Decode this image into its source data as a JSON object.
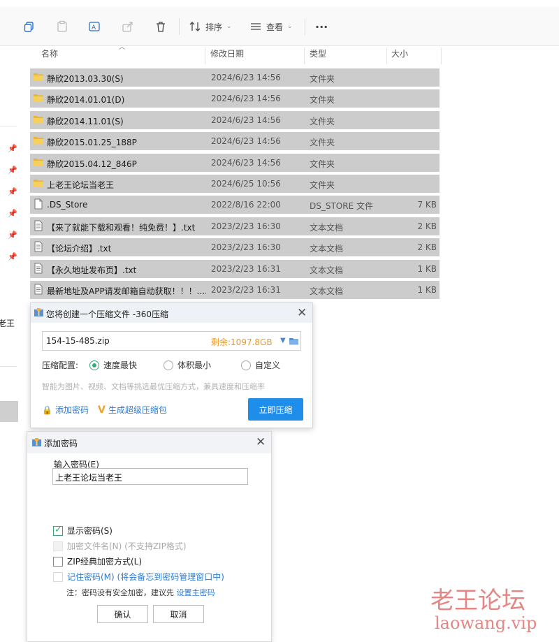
{
  "toolbar": {
    "sort_label": "排序",
    "view_label": "查看",
    "more_label": "···"
  },
  "columns": {
    "name": "名称",
    "date": "修改日期",
    "type": "类型",
    "size": "大小"
  },
  "files": [
    {
      "name": "静欣2013.03.30(S)",
      "date": "2024/6/23 14:56",
      "type": "文件夹",
      "size": "",
      "icon": "folder-icon",
      "selected": true
    },
    {
      "name": "静欣2014.01.01(D)",
      "date": "2024/6/23 14:56",
      "type": "文件夹",
      "size": "",
      "icon": "folder-icon",
      "selected": true
    },
    {
      "name": "静欣2014.11.01(S)",
      "date": "2024/6/23 14:56",
      "type": "文件夹",
      "size": "",
      "icon": "folder-icon",
      "selected": true
    },
    {
      "name": "静欣2015.01.25_188P",
      "date": "2024/6/23 14:56",
      "type": "文件夹",
      "size": "",
      "icon": "folder-icon",
      "selected": true
    },
    {
      "name": "静欣2015.04.12_846P",
      "date": "2024/6/23 14:56",
      "type": "文件夹",
      "size": "",
      "icon": "folder-icon",
      "selected": true
    },
    {
      "name": "上老王论坛当老王",
      "date": "2024/6/25 10:56",
      "type": "文件夹",
      "size": "",
      "icon": "folder-icon",
      "selected": true
    },
    {
      "name": ".DS_Store",
      "date": "2022/8/16 22:00",
      "type": "DS_STORE 文件",
      "size": "7 KB",
      "icon": "file-icon",
      "selected": true
    },
    {
      "name": "【来了就能下载和观看！纯免费！】.txt",
      "date": "2023/2/23 16:30",
      "type": "文本文档",
      "size": "2 KB",
      "icon": "text-file-icon",
      "selected": true
    },
    {
      "name": "【论坛介绍】.txt",
      "date": "2023/2/23 16:30",
      "type": "文本文档",
      "size": "2 KB",
      "icon": "text-file-icon",
      "selected": true
    },
    {
      "name": "【永久地址发布页】.txt",
      "date": "2023/2/23 16:31",
      "type": "文本文档",
      "size": "1 KB",
      "icon": "text-file-icon",
      "selected": true
    },
    {
      "name": "最新地址及APP请发邮箱自动获取！！！....",
      "date": "2023/2/23 16:31",
      "type": "文本文档",
      "size": "1 KB",
      "icon": "text-file-icon",
      "selected": true
    }
  ],
  "leftnav": {
    "partial_text": "老王"
  },
  "compress_dialog": {
    "title": "您将创建一个压缩文件 -360压缩",
    "filename": "154-15-485.zip",
    "free_space": "剩余:1097.8GB",
    "config_label": "压缩配置:",
    "options": [
      "速度最快",
      "体积最小",
      "自定义"
    ],
    "selected_option": "速度最快",
    "hint": "智能为图片、视频、文档等挑选最优压缩方式，兼具速度和压缩率",
    "add_password": "添加密码",
    "super_zip": "生成超级压缩包",
    "compress_now": "立即压缩"
  },
  "password_dialog": {
    "title": "添加密码",
    "input_label": "输入密码(E)",
    "password_value": "上老王论坛当老王",
    "show_password": "显示密码(S)",
    "encrypt_filename": "加密文件名(N) (不支持ZIP格式)",
    "zip_classic": "ZIP经典加密方式(L)",
    "remember_password": "记住密码(M) (将会备忘到密码管理窗口中)",
    "note_prefix": "注：密码没有安全加密，建议先",
    "note_link": "设置主密码",
    "ok": "确认",
    "cancel": "取消"
  },
  "watermark": {
    "cn": "老王论坛",
    "url": "laowang.vip"
  },
  "colors": {
    "accent": "#1f8eea",
    "selection": "#cccccc",
    "orange": "#e79a2d",
    "radio_green": "#3aa876"
  }
}
